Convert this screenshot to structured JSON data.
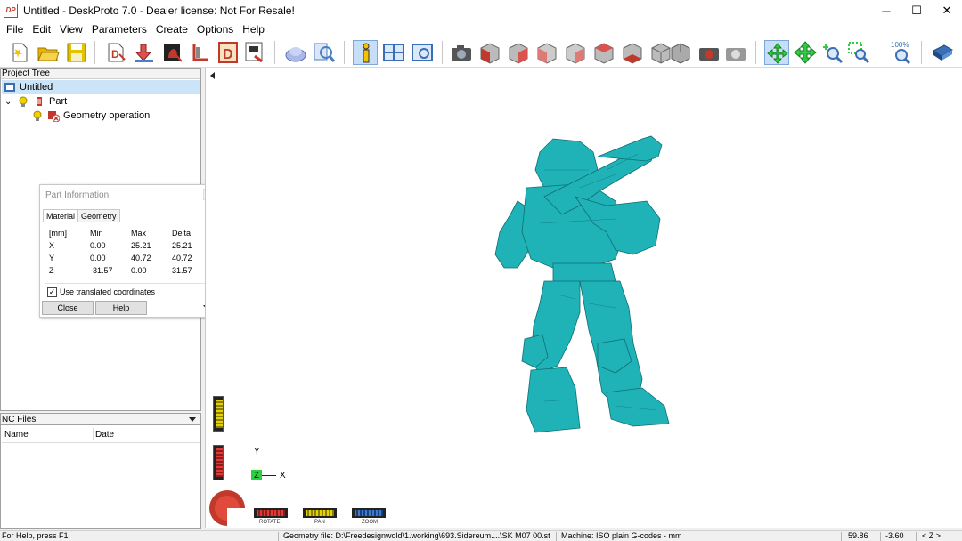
{
  "window": {
    "title": "Untitled - DeskProto 7.0 - Dealer license: Not For Resale!",
    "logo_text": "DP",
    "minimize_glyph": "─",
    "maximize_glyph": "☐",
    "close_glyph": "✕"
  },
  "menu": [
    "File",
    "Edit",
    "View",
    "Parameters",
    "Create",
    "Options",
    "Help"
  ],
  "toolbar": {
    "items": [
      "new-file",
      "open-file",
      "save-file",
      "part-import",
      "part-move",
      "part-view",
      "vector-import",
      "bitmap-import",
      "export",
      "cut-part",
      "zoom-part",
      "part-information",
      "layout-toggle",
      "screen-view",
      "camera-view",
      "view-front",
      "view-back",
      "view-left",
      "view-right",
      "view-top",
      "view-bottom",
      "view-iso-1",
      "view-iso-2",
      "render-settings",
      "render-options",
      "rotate-tool",
      "pan-tool",
      "zoom-tool",
      "zoom-window",
      "zoom-100",
      "help-book"
    ],
    "zoom_label": "100%"
  },
  "project_tree": {
    "header": "Project Tree",
    "root": "Untitled",
    "part": "Part",
    "operation": "Geometry operation",
    "expand_glyph": "⌄"
  },
  "part_info": {
    "title": "Part Information",
    "tabs": [
      "Material",
      "Geometry"
    ],
    "columns": [
      "[mm]",
      "Min",
      "Max",
      "Delta"
    ],
    "rows": [
      [
        "X",
        "0.00",
        "25.21",
        "25.21"
      ],
      [
        "Y",
        "0.00",
        "40.72",
        "40.72"
      ],
      [
        "Z",
        "-31.57",
        "0.00",
        "31.57"
      ]
    ],
    "checkbox_label": "Use translated coordinates",
    "checkbox_checked": true,
    "check_glyph": "✓",
    "close_button": "Close",
    "help_button": "Help"
  },
  "nc_files": {
    "header": "NC Files",
    "columns": [
      "Name",
      "Date"
    ]
  },
  "viewport": {
    "model_color": "#1fb3b8",
    "axis_y": "Y",
    "axis_x": "X",
    "axis_z": "Z",
    "modes": [
      "ROTATE",
      "PAN",
      "ZOOM"
    ]
  },
  "status": {
    "help": "For Help, press F1",
    "geometry_file": "Geometry file: D:\\Freedesignwold\\1.working\\693.Sidereum....\\SK M07 00.stl",
    "machine": "Machine: ISO plain G-codes - mm",
    "x": "59.86",
    "y": "-3.60",
    "axis": "< Z >"
  }
}
